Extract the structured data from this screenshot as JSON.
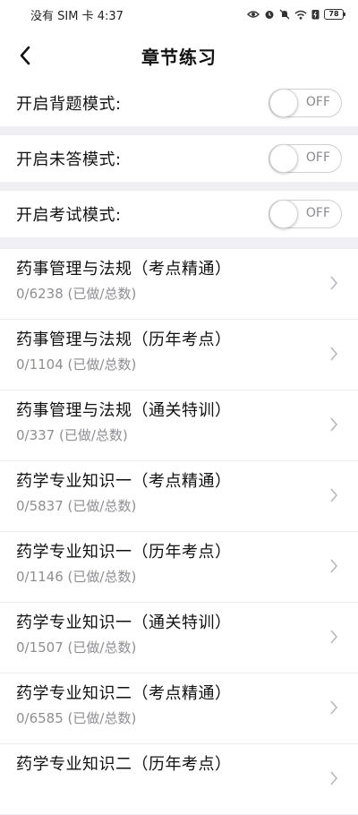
{
  "status_bar": {
    "carrier_time": "没有 SIM 卡 4:37",
    "battery_level": "78",
    "icons": [
      "eye-icon",
      "alarm-icon",
      "mute-icon",
      "wifi-icon",
      "battery-saver-icon",
      "battery-icon"
    ]
  },
  "header": {
    "title": "章节练习",
    "back_icon": "back-arrow-icon"
  },
  "toggles": [
    {
      "label": "开启背题模式:",
      "state": "OFF"
    },
    {
      "label": "开启未答模式:",
      "state": "OFF"
    },
    {
      "label": "开启考试模式:",
      "state": "OFF"
    }
  ],
  "chapters": [
    {
      "title": "药事管理与法规（考点精通）",
      "progress": "0/6238 (已做/总数)"
    },
    {
      "title": "药事管理与法规（历年考点）",
      "progress": "0/1104 (已做/总数)"
    },
    {
      "title": "药事管理与法规（通关特训）",
      "progress": "0/337 (已做/总数)"
    },
    {
      "title": "药学专业知识一（考点精通）",
      "progress": "0/5837 (已做/总数)"
    },
    {
      "title": "药学专业知识一（历年考点）",
      "progress": "0/1146 (已做/总数)"
    },
    {
      "title": "药学专业知识一（通关特训）",
      "progress": "0/1507 (已做/总数)"
    },
    {
      "title": "药学专业知识二（考点精通）",
      "progress": "0/6585 (已做/总数)"
    },
    {
      "title": "药学专业知识二（历年考点）",
      "progress": ""
    }
  ],
  "colors": {
    "separator": "#f0f0f4",
    "subtext": "#8e8e93",
    "switch_border": "#cfcfd4"
  }
}
